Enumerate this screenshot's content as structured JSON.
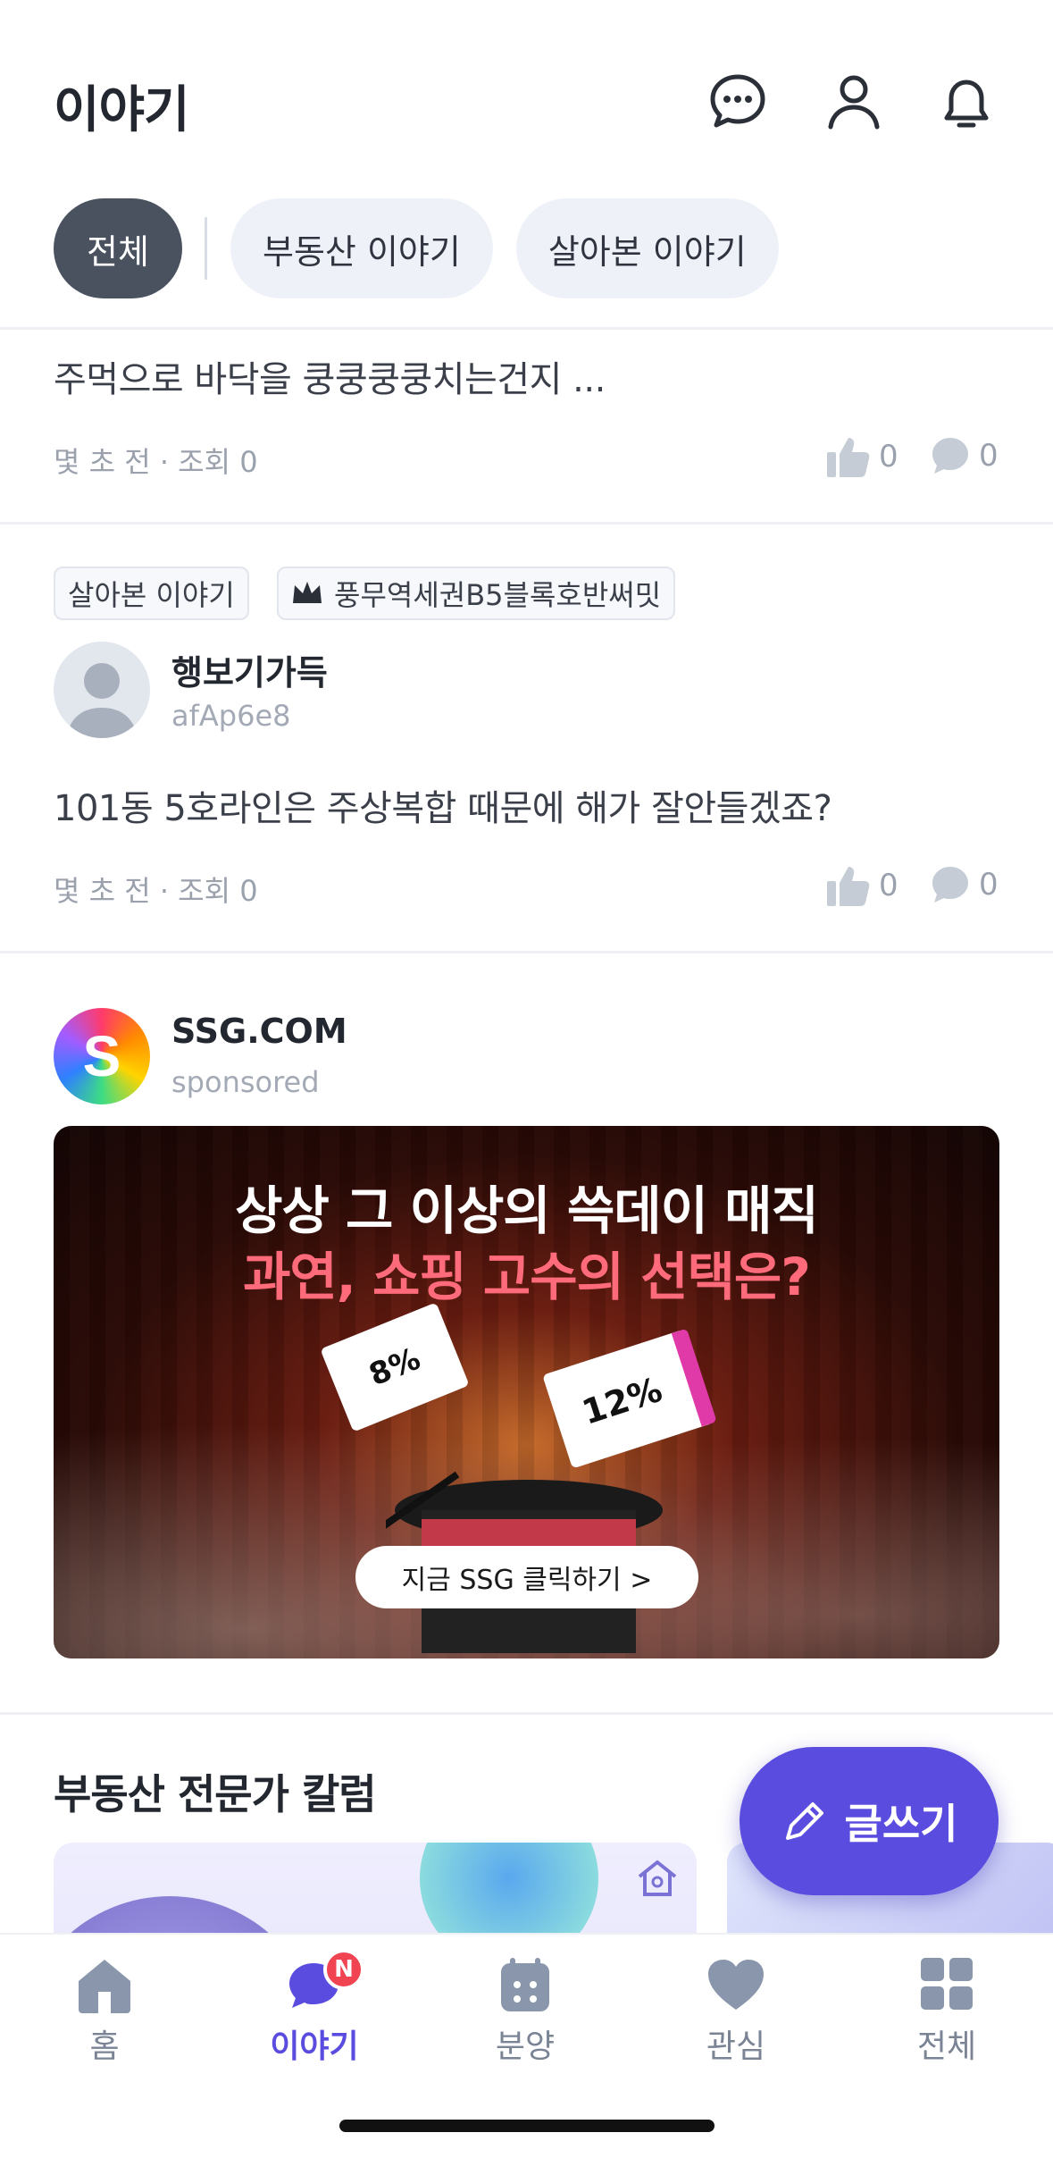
{
  "header": {
    "title": "이야기",
    "icons": [
      "chat-icon",
      "user-icon",
      "bell-icon"
    ]
  },
  "tabs": [
    {
      "label": "전체",
      "active": true
    },
    {
      "label": "부동산 이야기",
      "active": false
    },
    {
      "label": "살아본 이야기",
      "active": false
    }
  ],
  "posts": [
    {
      "body": "주먹으로 바닥을 쿵쿵쿵쿵치는건지 ...",
      "meta": "몇 초 전 · 조회 0",
      "likes": "0",
      "comments": "0"
    },
    {
      "category": "살아본 이야기",
      "complex": "풍무역세권B5블록호반써밋",
      "author": "행보기가득",
      "handle": "afAp6e8",
      "body": "101동 5호라인은 주상복합 때문에 해가 잘안들겠죠?",
      "meta": "몇 초 전 · 조회 0",
      "likes": "0",
      "comments": "0"
    }
  ],
  "sponsored": {
    "advertiser": "SSG.COM",
    "label": "sponsored",
    "logo_letter": "S",
    "headline_1": "상상 그 이상의 쓱데이 매직",
    "headline_2": "과연, 쇼핑 고수의 선택은?",
    "cta": "지금 SSG 클릭하기 >",
    "coupon_1": "8%",
    "coupon_2": "12%"
  },
  "column_section": {
    "title": "부동산 전문가 칼럼"
  },
  "fab": {
    "label": "글쓰기"
  },
  "bottom_nav": [
    {
      "label": "홈",
      "icon": "home-icon",
      "active": false
    },
    {
      "label": "이야기",
      "icon": "chat-bubble-icon",
      "active": true,
      "badge": "N"
    },
    {
      "label": "분양",
      "icon": "calendar-icon",
      "active": false
    },
    {
      "label": "관심",
      "icon": "heart-icon",
      "active": false
    },
    {
      "label": "전체",
      "icon": "grid-icon",
      "active": false
    }
  ],
  "colors": {
    "accent": "#5b4ce0",
    "active_tab": "#4a5260",
    "badge": "#f04452"
  }
}
